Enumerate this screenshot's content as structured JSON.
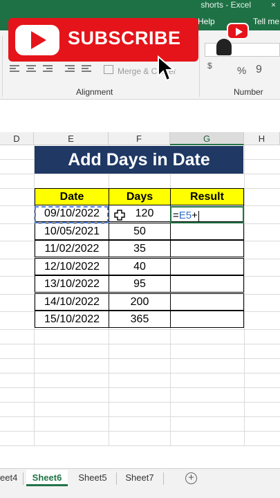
{
  "window": {
    "title": "shorts - Excel",
    "close_glyph": "×"
  },
  "ribbon": {
    "tabs": {
      "help": "Help",
      "tell_me": "Tell me"
    },
    "merge_label": "Merge & Center",
    "group_alignment": "Alignment",
    "group_number": "Number",
    "percent_glyph": "%",
    "comma_glyph": "9",
    "currency_glyph": "$"
  },
  "overlay": {
    "subscribe_text": "SUBSCRIBE"
  },
  "columns": [
    "D",
    "E",
    "F",
    "G",
    "H"
  ],
  "sheet_title": "Add Days in Date",
  "table": {
    "headers": [
      "Date",
      "Days",
      "Result"
    ],
    "rows": [
      {
        "date": "09/10/2022",
        "days": "120",
        "result": ""
      },
      {
        "date": "10/05/2021",
        "days": "50",
        "result": ""
      },
      {
        "date": "11/02/2022",
        "days": "35",
        "result": ""
      },
      {
        "date": "12/10/2022",
        "days": "40",
        "result": ""
      },
      {
        "date": "13/10/2022",
        "days": "95",
        "result": ""
      },
      {
        "date": "14/10/2022",
        "days": "200",
        "result": ""
      },
      {
        "date": "15/10/2022",
        "days": "365",
        "result": ""
      }
    ],
    "formula": {
      "prefix": "=",
      "ref": "E5",
      "suffix": "+"
    }
  },
  "sheets": {
    "tabs": [
      "eet4",
      "Sheet6",
      "Sheet5",
      "Sheet7"
    ],
    "active": "Sheet6",
    "add_glyph": "+"
  },
  "colors": {
    "excel_green": "#217346",
    "title_fill": "#1f3864",
    "header_fill": "#ffff00",
    "subscribe_red": "#e5141a"
  },
  "icons": [
    "play-icon",
    "bell-icon",
    "youtube-badge-icon",
    "mouse-pointer-icon",
    "cell-cross-cursor-icon",
    "add-sheet-icon"
  ]
}
